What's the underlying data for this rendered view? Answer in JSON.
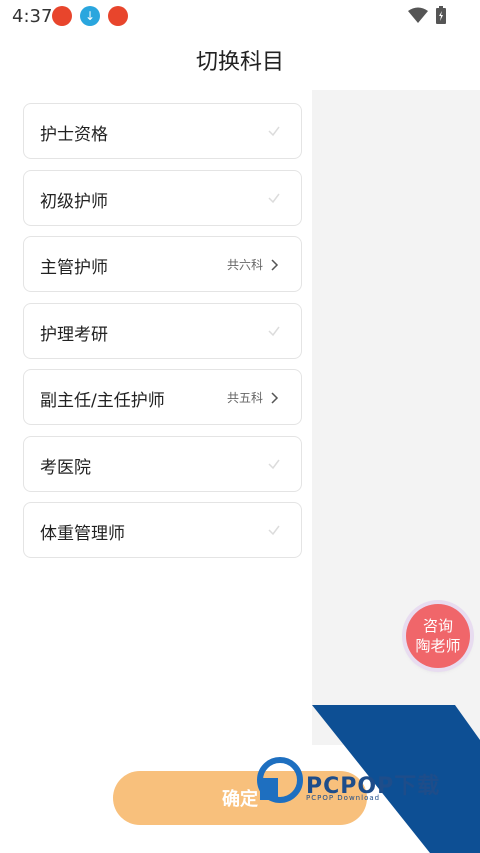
{
  "status_bar": {
    "time": "4:37"
  },
  "page_title": "切换科目",
  "subjects": [
    {
      "label": "护士资格",
      "count": "",
      "has_arrow": false
    },
    {
      "label": "初级护师",
      "count": "",
      "has_arrow": false
    },
    {
      "label": "主管护师",
      "count": "共六科",
      "has_arrow": true
    },
    {
      "label": "护理考研",
      "count": "",
      "has_arrow": false
    },
    {
      "label": "副主任/主任护师",
      "count": "共五科",
      "has_arrow": true
    },
    {
      "label": "考医院",
      "count": "",
      "has_arrow": false
    },
    {
      "label": "体重管理师",
      "count": "",
      "has_arrow": false
    }
  ],
  "consult": {
    "line1": "咨询",
    "line2": "陶老师"
  },
  "confirm_label": "确定",
  "watermark": {
    "brand": "PCPOP下载",
    "sub": "PCPOP Download"
  },
  "colors": {
    "accent": "#f8c07c",
    "consult": "#f0666a",
    "panel": "#f3f3f3",
    "watermark": "#1e4d8a"
  }
}
